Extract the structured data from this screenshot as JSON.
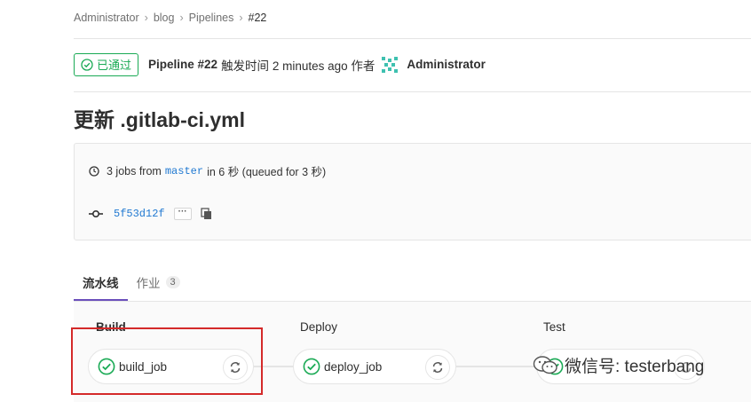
{
  "breadcrumb": {
    "items": [
      "Administrator",
      "blog",
      "Pipelines"
    ],
    "current": "#22",
    "separator": "›"
  },
  "header": {
    "status": "已通过",
    "pipeline": "Pipeline #22",
    "triggered_text": "触发时间 2 minutes ago 作者",
    "author": "Administrator",
    "status_color": "#1aaa55"
  },
  "commit": {
    "title": "更新 .gitlab-ci.yml"
  },
  "info": {
    "jobs_text_pre": "3 jobs from",
    "branch": "master",
    "jobs_text_post": "in 6 秒 (queued for 3 秒)",
    "sha": "5f53d12f",
    "ellipsis": "···"
  },
  "tabs": [
    {
      "label": "流水线",
      "active": true
    },
    {
      "label": "作业",
      "count": "3",
      "active": false
    }
  ],
  "stages": [
    {
      "name": "Build",
      "job": "build_job"
    },
    {
      "name": "Deploy",
      "job": "deploy_job"
    },
    {
      "name": "Test",
      "job": ""
    }
  ],
  "watermark": {
    "text": "微信号: testerbang"
  },
  "colors": {
    "accent": "#6b4fbb",
    "success": "#1aaa55",
    "highlight": "#d42a2a",
    "link": "#1f78d1"
  }
}
